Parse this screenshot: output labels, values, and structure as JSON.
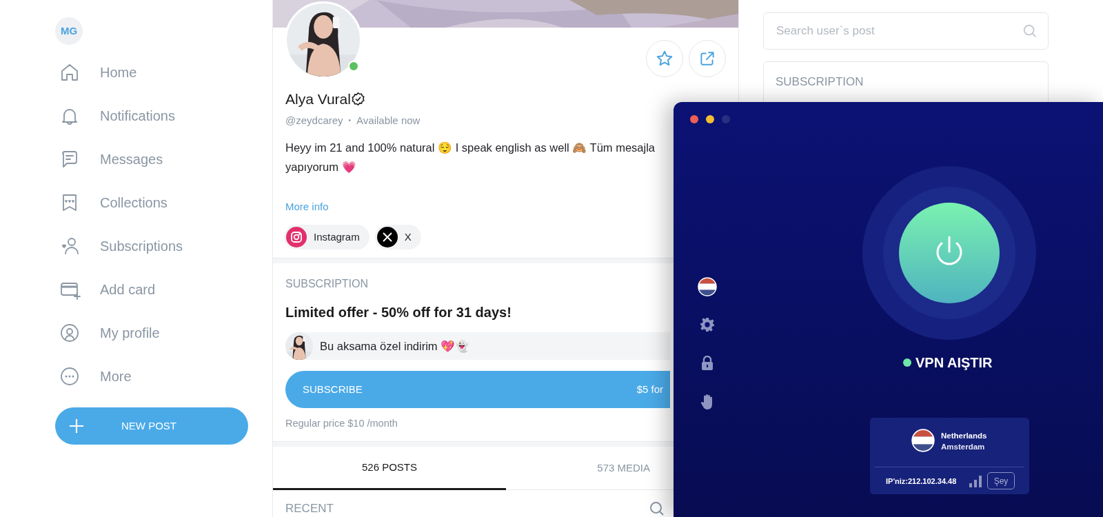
{
  "sidebar": {
    "avatar_initials": "MG",
    "items": [
      {
        "kind": "home",
        "label": "Home"
      },
      {
        "kind": "bell",
        "label": "Notifications"
      },
      {
        "kind": "chat",
        "label": "Messages"
      },
      {
        "kind": "bookmark",
        "label": "Collections"
      },
      {
        "kind": "person",
        "label": "Subscriptions"
      },
      {
        "kind": "card",
        "label": "Add card"
      },
      {
        "kind": "profile",
        "label": "My profile"
      },
      {
        "kind": "more",
        "label": "More"
      }
    ],
    "new_post": "NEW POST"
  },
  "profile": {
    "name": "Alya Vural",
    "verified": true,
    "online": true,
    "handle": "@zeydcarey",
    "separator": "•",
    "availability": "Available now",
    "bio": [
      "Heyy im 21 and 100% natural 😌 I speak english as well 🙈 Tüm mesajla",
      "yapıyorum 💗"
    ],
    "more_info": "More info",
    "socials": [
      {
        "kind": "instagram",
        "label": "Instagram"
      },
      {
        "kind": "x",
        "label": "X"
      }
    ]
  },
  "subscription": {
    "heading": "SUBSCRIPTION",
    "offer": "Limited offer - 50% off for 31 days!",
    "message": "Bu aksama özel indirim 💖👻",
    "button_label": "SUBSCRIBE",
    "button_price": "$5 for",
    "regular_price": "Regular price $10 /month"
  },
  "tabs": [
    {
      "label": "526 POSTS",
      "selected": true
    },
    {
      "label": "573 MEDIA",
      "selected": false
    }
  ],
  "recent": {
    "heading": "RECENT"
  },
  "right_panel": {
    "search": {
      "placeholder": "Search user`s post"
    },
    "subscription_heading": "SUBSCRIPTION"
  },
  "vpn": {
    "connected": true,
    "status": "VPN AIŞTIR",
    "location": {
      "country": "Netherlands",
      "city": "Amsterdam"
    },
    "ip": "IP'niz:212.102.34.48",
    "button": "Şey"
  }
}
